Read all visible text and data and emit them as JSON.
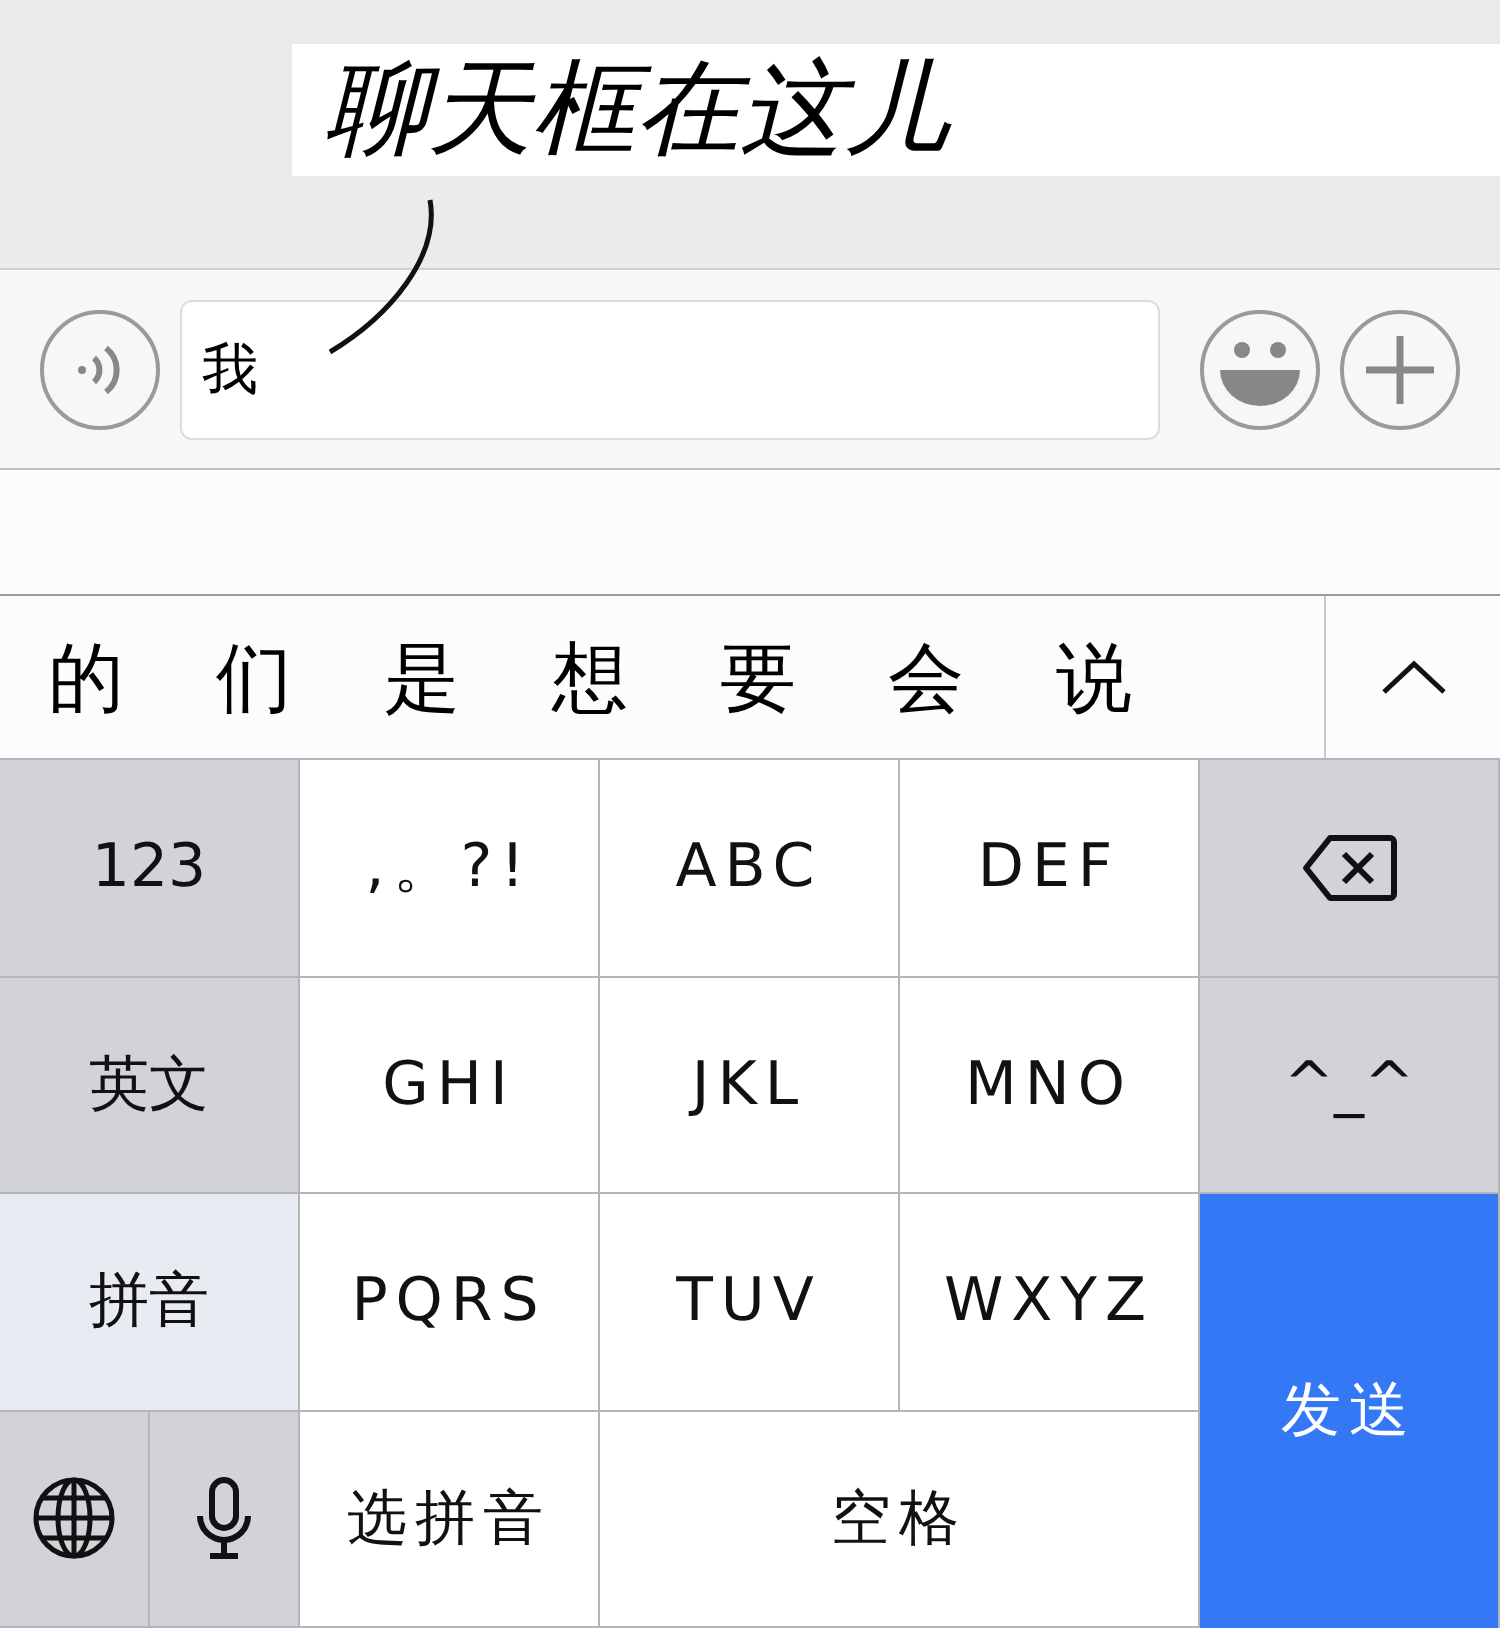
{
  "annotation": {
    "text": "聊天框在这儿"
  },
  "input_bar": {
    "value": "我"
  },
  "candidates": {
    "words": [
      "的",
      "们",
      "是",
      "想",
      "要",
      "会",
      "说"
    ]
  },
  "keyboard": {
    "keys": [
      {
        "kind": "function",
        "label": "123"
      },
      {
        "kind": "letter",
        "label": ",。?!"
      },
      {
        "kind": "letter",
        "label": "ABC"
      },
      {
        "kind": "letter",
        "label": "DEF"
      },
      {
        "kind": "delete"
      },
      {
        "kind": "mode",
        "label": "英文",
        "selected": false
      },
      {
        "kind": "letter",
        "label": "GHI"
      },
      {
        "kind": "letter",
        "label": "JKL"
      },
      {
        "kind": "letter",
        "label": "MNO"
      },
      {
        "kind": "function",
        "label": "^_^"
      },
      {
        "kind": "mode",
        "label": "拼音",
        "selected": true
      },
      {
        "kind": "letter",
        "label": "PQRS"
      },
      {
        "kind": "letter",
        "label": "TUV"
      },
      {
        "kind": "letter",
        "label": "WXYZ"
      },
      {
        "kind": "send",
        "label": "发送"
      },
      {
        "kind": "globe"
      },
      {
        "kind": "mic"
      },
      {
        "kind": "letter",
        "label": "选拼音"
      },
      {
        "kind": "letter",
        "label": "空格"
      }
    ]
  }
}
